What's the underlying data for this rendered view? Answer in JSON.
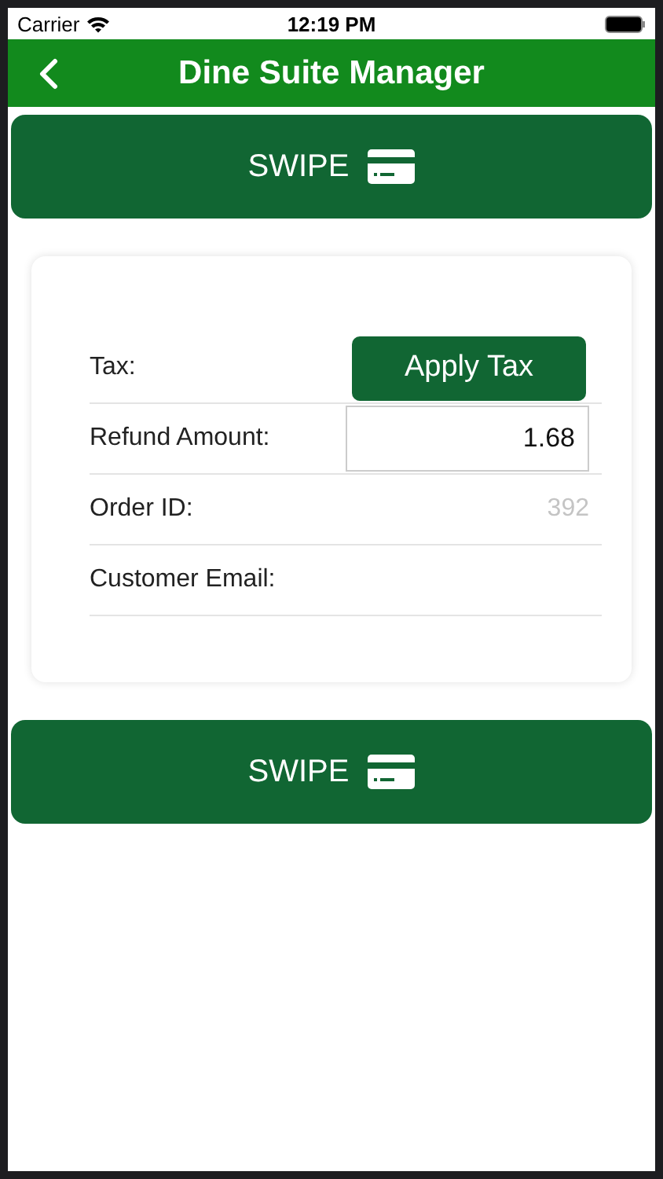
{
  "status_bar": {
    "carrier": "Carrier",
    "time": "12:19 PM"
  },
  "nav": {
    "title": "Dine Suite Manager"
  },
  "swipe_buttons": [
    {
      "label": "SWIPE"
    },
    {
      "label": "SWIPE"
    }
  ],
  "form_rows": [
    {
      "kind": "button",
      "label": "Tax:",
      "button": "Apply Tax"
    },
    {
      "kind": "input",
      "label": "Refund Amount:",
      "value": "1.68"
    },
    {
      "kind": "value",
      "label": "Order ID:",
      "value": "392"
    },
    {
      "kind": "empty",
      "label": "Customer Email:"
    }
  ]
}
